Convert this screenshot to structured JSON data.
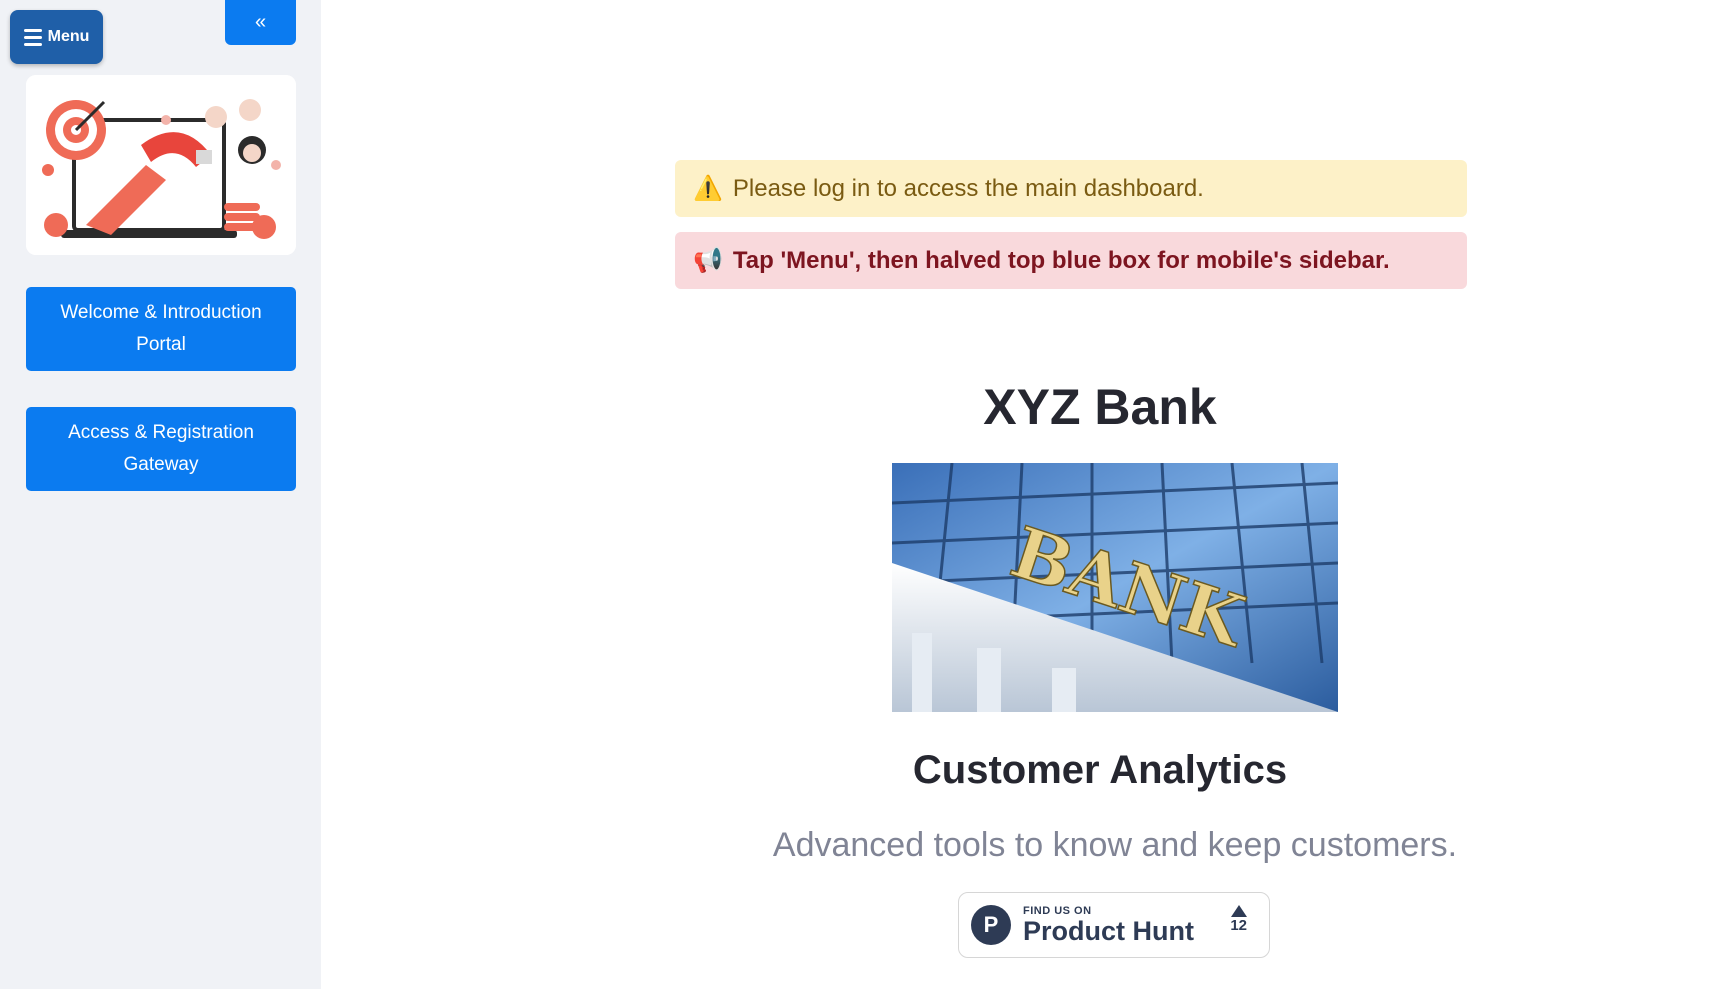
{
  "sidebar": {
    "menu_label": "Menu",
    "collapse_glyph": "«",
    "nav": [
      {
        "label": "Welcome & Introduction Portal"
      },
      {
        "label": "Access & Registration Gateway"
      }
    ]
  },
  "alerts": {
    "warning_icon": "⚠️",
    "warning_text": "Please log in to access the main dashboard.",
    "error_icon": "📢",
    "error_text": "Tap 'Menu', then halved top blue box for mobile's sidebar."
  },
  "main": {
    "title": "XYZ Bank",
    "image_sign_text": "BANK",
    "subtitle": "Customer Analytics",
    "tagline": "Advanced tools to know and keep customers."
  },
  "product_hunt": {
    "logo_letter": "P",
    "small_text": "FIND US ON",
    "big_text": "Product Hunt",
    "votes": "12"
  },
  "colors": {
    "sidebar_bg": "#f0f2f6",
    "primary_button": "#0b7bf0",
    "menu_button": "#1f5fa8",
    "warning_bg": "#fdf1c8",
    "error_bg": "#f9d9dc"
  }
}
